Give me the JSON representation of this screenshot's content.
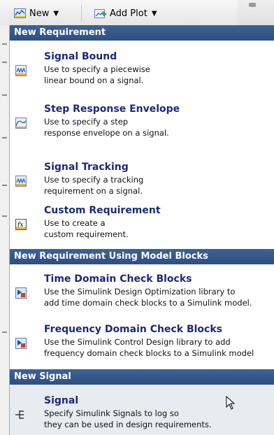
{
  "toolbar": {
    "new_label": "New",
    "add_plot_label": "Add Plot"
  },
  "menu": {
    "sections": [
      {
        "header": "New Requirement",
        "items": [
          {
            "title": "Signal Bound",
            "desc": [
              "Use to specify a piecewise",
              "linear bound on a signal."
            ],
            "icon": "signal-bound-icon"
          },
          {
            "title": "Step Response Envelope",
            "desc": [
              "Use to specify a step",
              "response envelope on a signal."
            ],
            "icon": "step-response-icon"
          },
          {
            "title": "Signal Tracking",
            "desc": [
              "Use to specify a tracking",
              "requirement on a signal."
            ],
            "icon": "signal-tracking-icon"
          },
          {
            "title": "Custom Requirement",
            "desc": [
              "Use to create a",
              "custom requirement."
            ],
            "icon": "custom-requirement-icon"
          }
        ]
      },
      {
        "header": "New Requirement Using Model Blocks",
        "items": [
          {
            "title": "Time Domain Check Blocks",
            "desc": [
              "Use the Simulink Design Optimization library to",
              "add time domain check blocks to a Simulink model."
            ],
            "icon": "simulink-block-icon"
          },
          {
            "title": "Frequency Domain Check Blocks",
            "desc": [
              "Use the Simulink Control Design library to add",
              "frequency domain check blocks to a Simulink model"
            ],
            "icon": "simulink-block-icon"
          }
        ]
      },
      {
        "header": "New Signal",
        "items": [
          {
            "title": "Signal",
            "desc": [
              "Specify Simulink Signals to log so",
              "they can be used in design requirements."
            ],
            "icon": "signal-icon"
          }
        ]
      }
    ]
  }
}
